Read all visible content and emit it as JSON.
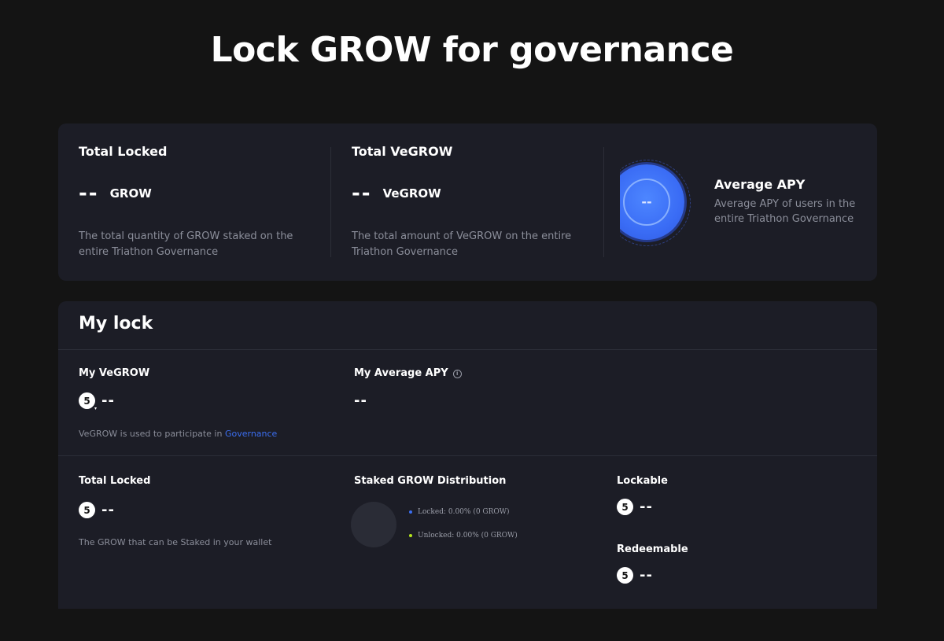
{
  "page_title": "Lock GROW for governance",
  "stats": {
    "total_locked": {
      "title": "Total Locked",
      "value": "--",
      "unit": "GROW",
      "description": "The total quantity of GROW staked on the entire Triathon Governance"
    },
    "total_vegrow": {
      "title": "Total VeGROW",
      "value": "--",
      "unit": "VeGROW",
      "description": "The total amount of VeGROW on the entire Triathon Governance"
    },
    "average_apy": {
      "title": "Average APY",
      "value": "--",
      "description": "Average APY of users in the entire Triathon Governance"
    }
  },
  "my_lock": {
    "title": "My lock",
    "my_vegrow": {
      "label": "My VeGROW",
      "value": "--",
      "note_prefix": "VeGROW is used to participate in ",
      "note_link": "Governance"
    },
    "my_average_apy": {
      "label": "My Average APY",
      "value": "--"
    },
    "total_locked": {
      "label": "Total Locked",
      "value": "--",
      "description": "The GROW that can be Staked in your wallet"
    },
    "distribution": {
      "label": "Staked GROW Distribution",
      "locked": "Locked: 0.00% (0 GROW)",
      "unlocked": "Unlocked: 0.00% (0 GROW)"
    },
    "lockable": {
      "label": "Lockable",
      "value": "--"
    },
    "redeemable": {
      "label": "Redeemable",
      "value": "--"
    }
  },
  "colors": {
    "background": "#141414",
    "card": "#1c1d26",
    "accent": "#3b6ef0",
    "locked_dot": "#3b6ef0",
    "unlocked_dot": "#b5e61d"
  },
  "icons": {
    "token": "grow-coin-icon",
    "info": "info-icon"
  }
}
